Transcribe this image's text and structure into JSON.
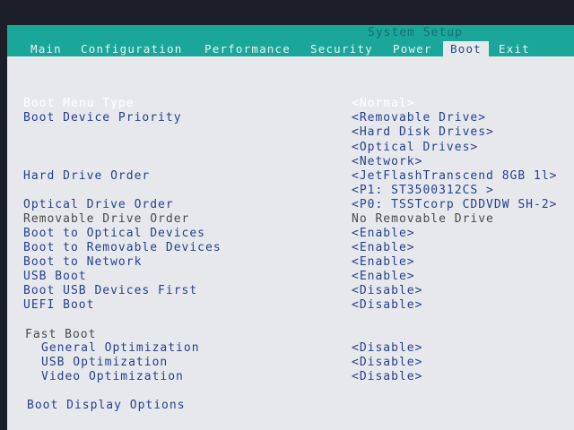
{
  "window": {
    "title": "System Setup"
  },
  "tabs": [
    {
      "label": "Main"
    },
    {
      "label": "Configuration"
    },
    {
      "label": "Performance"
    },
    {
      "label": "Security"
    },
    {
      "label": "Power"
    },
    {
      "label": "Boot"
    },
    {
      "label": "Exit"
    }
  ],
  "settings": [
    {
      "label": "Boot Menu Type",
      "value": "<Normal>"
    },
    {
      "label": "Boot Device Priority",
      "values": [
        "<Removable Drive>",
        "<Hard Disk Drives>",
        "<Optical Drives>",
        "<Network>"
      ]
    },
    {
      "label": "Hard Drive Order",
      "values": [
        "<JetFlashTranscend 8GB 1l>",
        "<P1: ST3500312CS          >"
      ]
    },
    {
      "label": "Optical Drive Order",
      "value": "<P0: TSSTcorp CDDVDW SH-2>"
    },
    {
      "label": "Removable Drive Order",
      "value": "No Removable Drive"
    },
    {
      "label": "Boot to Optical Devices",
      "value": "<Enable>"
    },
    {
      "label": "Boot to Removable Devices",
      "value": "<Enable>"
    },
    {
      "label": "Boot to Network",
      "value": "<Enable>"
    },
    {
      "label": "USB Boot",
      "value": "<Enable>"
    },
    {
      "label": "Boot USB Devices First",
      "value": "<Disable>"
    },
    {
      "label": "UEFI Boot",
      "value": "<Disable>"
    }
  ],
  "fast_boot": {
    "heading": "Fast Boot",
    "items": [
      {
        "label": "General Optimization",
        "value": "<Disable>"
      },
      {
        "label": "USB Optimization",
        "value": "<Disable>"
      },
      {
        "label": "Video Optimization",
        "value": "<Disable>"
      }
    ]
  },
  "boot_display": {
    "label": "Boot Display Options"
  }
}
